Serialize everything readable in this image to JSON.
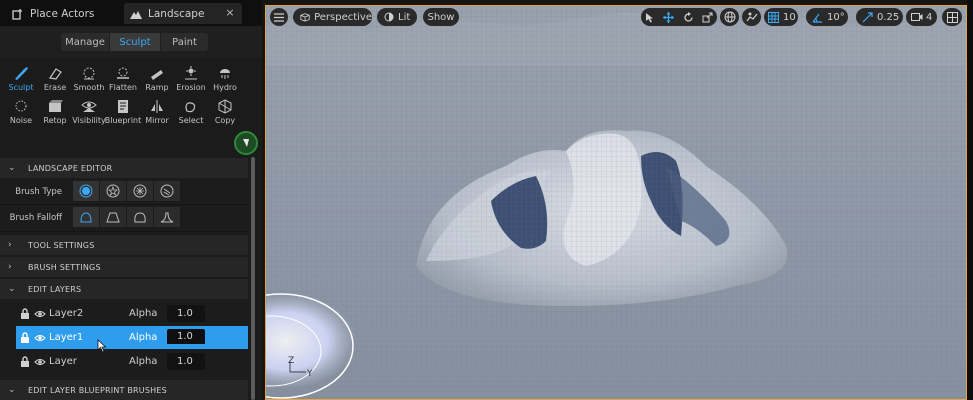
{
  "tabs": {
    "place_actors": "Place Actors",
    "landscape": "Landscape",
    "close": "×"
  },
  "modes": {
    "manage": "Manage",
    "sculpt": "Sculpt",
    "paint": "Paint",
    "active": "Sculpt"
  },
  "tools": [
    {
      "label": "Sculpt",
      "icon": "sculpt-brush-icon",
      "active": true
    },
    {
      "label": "Erase",
      "icon": "erase-icon"
    },
    {
      "label": "Smooth",
      "icon": "smooth-icon"
    },
    {
      "label": "Flatten",
      "icon": "flatten-icon"
    },
    {
      "label": "Ramp",
      "icon": "ramp-icon"
    },
    {
      "label": "Erosion",
      "icon": "erosion-icon"
    },
    {
      "label": "Hydro",
      "icon": "hydro-icon"
    },
    {
      "label": "Noise",
      "icon": "noise-icon"
    },
    {
      "label": "Retop",
      "icon": "retop-icon"
    },
    {
      "label": "Visibility",
      "icon": "visibility-icon"
    },
    {
      "label": "Blueprint",
      "icon": "blueprint-icon"
    },
    {
      "label": "Mirror",
      "icon": "mirror-icon"
    },
    {
      "label": "Select",
      "icon": "select-icon"
    },
    {
      "label": "Copy",
      "icon": "copy-icon"
    }
  ],
  "sections": {
    "landscape_editor": "LANDSCAPE EDITOR",
    "tool_settings": "TOOL SETTINGS",
    "brush_settings": "BRUSH SETTINGS",
    "edit_layers": "EDIT LAYERS",
    "edit_layer_bp_brushes": "EDIT LAYER BLUEPRINT BRUSHES"
  },
  "brush": {
    "type_label": "Brush Type",
    "falloff_label": "Brush Falloff"
  },
  "layers": [
    {
      "name": "Layer2",
      "alpha_label": "Alpha",
      "alpha": "1.0",
      "selected": false
    },
    {
      "name": "Layer1",
      "alpha_label": "Alpha",
      "alpha": "1.0",
      "selected": true
    },
    {
      "name": "Layer",
      "alpha_label": "Alpha",
      "alpha": "1.0",
      "selected": false
    }
  ],
  "viewport": {
    "perspective": "Perspective",
    "lit": "Lit",
    "show": "Show",
    "grid_snap": "10",
    "rot_snap": "10°",
    "scale_snap": "0.25",
    "cam_speed": "4",
    "axis_z": "Z",
    "axis_y": "Y"
  },
  "colors": {
    "accent": "#2f9ded",
    "accent_text": "#3ca9f5",
    "viewport_border": "#e9a33b"
  }
}
